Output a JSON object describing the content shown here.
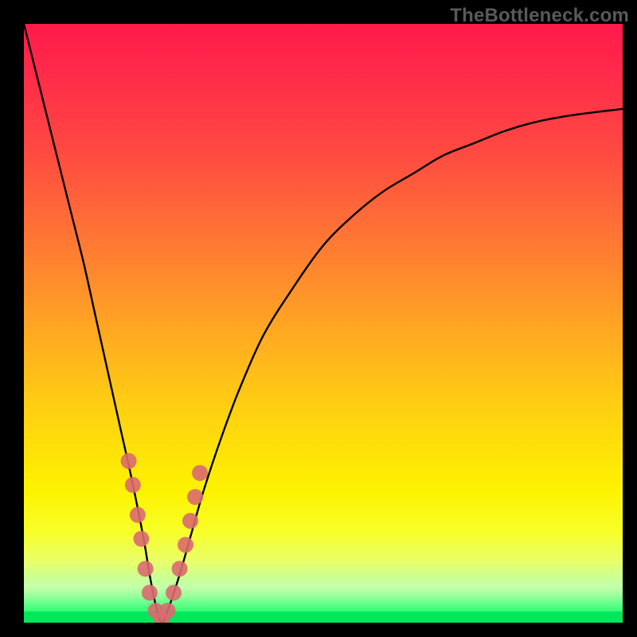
{
  "watermark": "TheBottleneck.com",
  "chart_data": {
    "type": "line",
    "title": "",
    "xlabel": "",
    "ylabel": "",
    "xlim": [
      0,
      100
    ],
    "ylim": [
      0,
      100
    ],
    "series": [
      {
        "name": "bottleneck-curve",
        "x": [
          0,
          2,
          4,
          6,
          8,
          10,
          12,
          14,
          16,
          18,
          20,
          21,
          22,
          23,
          24,
          26,
          28,
          30,
          33,
          36,
          40,
          45,
          50,
          55,
          60,
          65,
          70,
          75,
          80,
          85,
          90,
          95,
          100
        ],
        "y": [
          100,
          92,
          84,
          76,
          68,
          60,
          51,
          42,
          33,
          24,
          14,
          8,
          3,
          0,
          2,
          8,
          15,
          22,
          31,
          39,
          48,
          56,
          63,
          68,
          72,
          75,
          78,
          80,
          82,
          83.5,
          84.5,
          85.2,
          85.8
        ]
      }
    ],
    "markers": {
      "name": "dot-markers",
      "color": "#d96a6f",
      "points": [
        {
          "x": 17.5,
          "y": 27
        },
        {
          "x": 18.2,
          "y": 23
        },
        {
          "x": 19.0,
          "y": 18
        },
        {
          "x": 19.6,
          "y": 14
        },
        {
          "x": 20.3,
          "y": 9
        },
        {
          "x": 21.0,
          "y": 5
        },
        {
          "x": 22.0,
          "y": 2
        },
        {
          "x": 23.0,
          "y": 0.5
        },
        {
          "x": 24.0,
          "y": 2
        },
        {
          "x": 25.0,
          "y": 5
        },
        {
          "x": 26.0,
          "y": 9
        },
        {
          "x": 27.0,
          "y": 13
        },
        {
          "x": 27.8,
          "y": 17
        },
        {
          "x": 28.6,
          "y": 21
        },
        {
          "x": 29.4,
          "y": 25
        }
      ]
    },
    "optimum_x": 23
  }
}
